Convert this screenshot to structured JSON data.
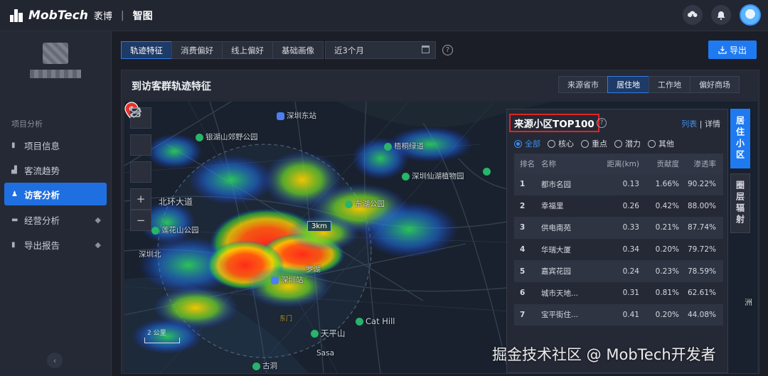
{
  "header": {
    "brand": "MobTech",
    "brand_sub": "袤博",
    "separator": "|",
    "product": "智图",
    "icons": [
      "cloud-download-icon",
      "bell-icon",
      "avatar"
    ]
  },
  "sidebar": {
    "section_label": "项目分析",
    "items": [
      {
        "label": "项目信息",
        "icon": "document-icon"
      },
      {
        "label": "客流趋势",
        "icon": "bar-chart-icon"
      },
      {
        "label": "访客分析",
        "icon": "user-icon",
        "active": true
      },
      {
        "label": "经营分析",
        "icon": "folder-icon",
        "premium": true
      },
      {
        "label": "导出报告",
        "icon": "report-icon",
        "premium": true
      }
    ],
    "collapse": "‹"
  },
  "toolbar": {
    "tabs": [
      "轨迹特征",
      "消费偏好",
      "线上偏好",
      "基础画像"
    ],
    "active_tab": "轨迹特征",
    "date_value": "近3个月",
    "export_label": "导出"
  },
  "panel": {
    "title": "到访客群轨迹特征",
    "view_tabs": [
      "来源省市",
      "居住地",
      "工作地",
      "偏好商场"
    ],
    "active_view": "居住地"
  },
  "map": {
    "labels": {
      "shenzhen_east": "深圳东站",
      "yinhu": "银湖山郊野公园",
      "wutong": "梧桐绿道",
      "xianhu": "深圳仙湖植物园",
      "beihuan": "北环大道",
      "donghu": "东湖公园",
      "lianhua": "莲花山公园",
      "shenzhen_north": "深圳北",
      "shenzhen_station": "深圳站",
      "catHill": "Cat Hill",
      "tianping": "天平山",
      "sasa": "Sasa",
      "dongmen": "东门",
      "luohu": "罗湖",
      "gu": "古洞",
      "partial_east": "洲"
    },
    "radius_label": "3km",
    "scale_label": "2 公里",
    "tools": [
      "ruler-icon",
      "layers-icon",
      "fullscreen-icon",
      "zoom-in-icon",
      "zoom-out-icon"
    ]
  },
  "source_list": {
    "title": "来源小区TOP100",
    "links": {
      "list": "列表",
      "sep": "|",
      "detail": "详情"
    },
    "filters": [
      "全部",
      "核心",
      "重点",
      "潜力",
      "其他"
    ],
    "active_filter": "全部",
    "columns": [
      "排名",
      "名称",
      "距离(km)",
      "贡献度",
      "渗透率"
    ],
    "rows": [
      [
        "1",
        "都市名园",
        "0.13",
        "1.66%",
        "90.22%"
      ],
      [
        "2",
        "幸福里",
        "0.26",
        "0.42%",
        "88.00%"
      ],
      [
        "3",
        "供电南苑",
        "0.33",
        "0.21%",
        "87.74%"
      ],
      [
        "4",
        "华瑞大厦",
        "0.34",
        "0.20%",
        "79.72%"
      ],
      [
        "5",
        "嘉宾花园",
        "0.24",
        "0.23%",
        "78.59%"
      ],
      [
        "6",
        "城市天地...",
        "0.31",
        "0.81%",
        "62.61%"
      ],
      [
        "7",
        "宝平街住...",
        "0.41",
        "0.20%",
        "44.08%"
      ]
    ],
    "side_tabs": [
      "居住小区",
      "圈层辐射"
    ]
  },
  "watermark": "掘金技术社区 @ MobTech开发者"
}
